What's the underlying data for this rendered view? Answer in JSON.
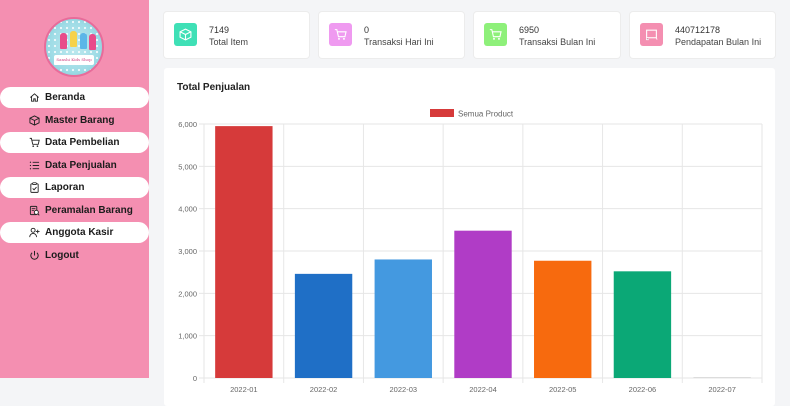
{
  "sidebar": {
    "logo_text": "Sanshi Kids Shop",
    "items": [
      {
        "label": "Beranda",
        "icon": "home-icon"
      },
      {
        "label": "Master Barang",
        "icon": "box-icon"
      },
      {
        "label": "Data Pembelian",
        "icon": "cart-icon"
      },
      {
        "label": "Data Penjualan",
        "icon": "list-icon"
      },
      {
        "label": "Laporan",
        "icon": "clipboard-icon"
      },
      {
        "label": "Peramalan Barang",
        "icon": "forecast-icon"
      },
      {
        "label": "Anggota Kasir",
        "icon": "user-add-icon"
      },
      {
        "label": "Logout",
        "icon": "power-icon"
      }
    ]
  },
  "stats": [
    {
      "value": "7149",
      "label": "Total Item",
      "color": "#3fe0b6",
      "icon": "box-icon"
    },
    {
      "value": "0",
      "label": "Transaksi Hari Ini",
      "color": "#ef9af0",
      "icon": "cart-icon"
    },
    {
      "value": "6950",
      "label": "Transaksi Bulan Ini",
      "color": "#8ef07a",
      "icon": "cart-icon"
    },
    {
      "value": "440712178",
      "label": "Pendapatan Bulan Ini",
      "color": "#f48fb1",
      "icon": "money-icon"
    }
  ],
  "panel": {
    "title": "Total Penjualan"
  },
  "chart_data": {
    "type": "bar",
    "legend": {
      "label": "Semua Product",
      "color": "#d63a3a",
      "position": "top"
    },
    "categories": [
      "2022-01",
      "2022-02",
      "2022-03",
      "2022-04",
      "2022-05",
      "2022-06",
      "2022-07"
    ],
    "series": [
      {
        "name": "Semua Product",
        "values": [
          5950,
          2460,
          2800,
          3480,
          2770,
          2520,
          20
        ]
      }
    ],
    "colors": [
      "#d63a3a",
      "#1f6fc6",
      "#4499e0",
      "#b03cc6",
      "#f76a0e",
      "#0ba876",
      "#d6d6d6"
    ],
    "ylim": [
      0,
      6000
    ],
    "yticks": [
      "0",
      "1,000",
      "2,000",
      "3,000",
      "4,000",
      "5,000",
      "6,000"
    ],
    "grid": true
  }
}
